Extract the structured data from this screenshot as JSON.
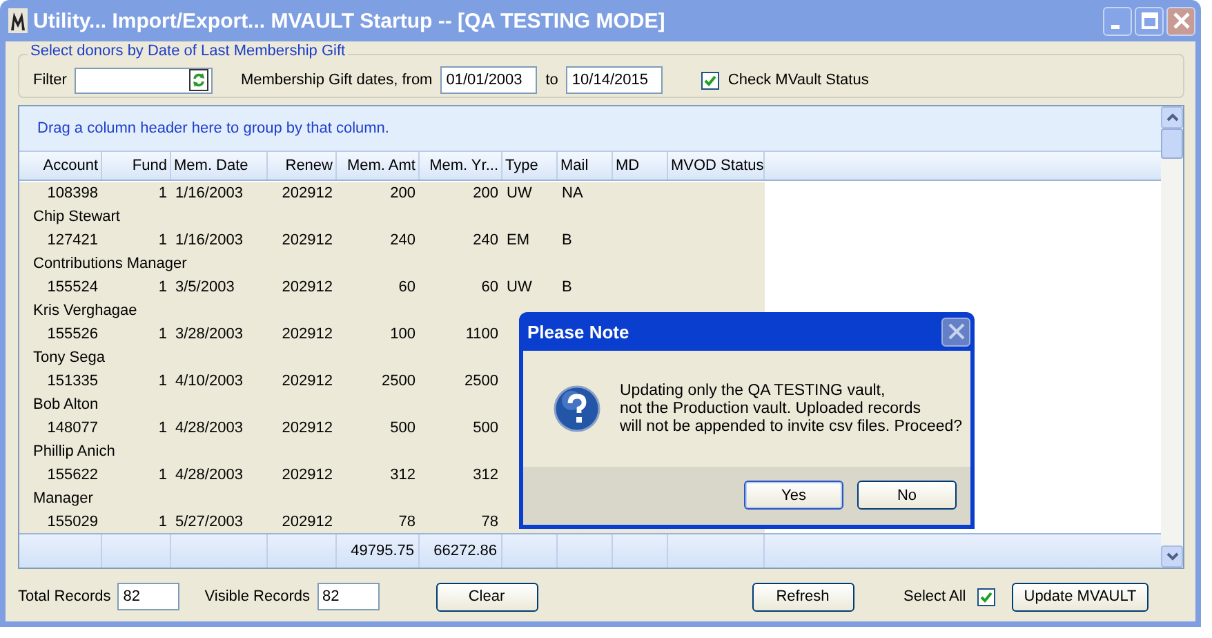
{
  "window": {
    "title": "Utility... Import/Export... MVAULT Startup -- [QA TESTING MODE]"
  },
  "criteria": {
    "legend": "Select donors by Date of Last Membership Gift",
    "filter_label": "Filter",
    "dates_label": "Membership Gift dates, from",
    "date_from": "01/01/2003",
    "to_label": "to",
    "date_to": "10/14/2015",
    "check_label": "Check MVault Status",
    "check_checked": true
  },
  "grid": {
    "group_hint": "Drag a column header here to group by that column.",
    "columns": [
      {
        "label": "Account"
      },
      {
        "label": "Fund"
      },
      {
        "label": "Mem. Date"
      },
      {
        "label": "Renew"
      },
      {
        "label": "Mem. Amt",
        "total": "49795.75"
      },
      {
        "label": "Mem. Yr...",
        "total": "66272.86"
      },
      {
        "label": "Type"
      },
      {
        "label": "Mail"
      },
      {
        "label": "MD"
      },
      {
        "label": "MVOD Status"
      }
    ],
    "rows": [
      {
        "cells": [
          "108398",
          "1",
          "1/16/2003",
          "202912",
          "200",
          "200",
          "UW",
          "NA"
        ],
        "preview": "Chip Stewart"
      },
      {
        "cells": [
          "127421",
          "1",
          "1/16/2003",
          "202912",
          "240",
          "240",
          "EM",
          "B"
        ],
        "preview": "Contributions Manager"
      },
      {
        "cells": [
          "155524",
          "1",
          "3/5/2003",
          "202912",
          "60",
          "60",
          "UW",
          "B"
        ],
        "preview": "Kris Verghagae"
      },
      {
        "cells": [
          "155526",
          "1",
          "3/28/2003",
          "202912",
          "100",
          "1100"
        ],
        "preview": "Tony Sega"
      },
      {
        "cells": [
          "151335",
          "1",
          "4/10/2003",
          "202912",
          "2500",
          "2500"
        ],
        "preview": "Bob Alton"
      },
      {
        "cells": [
          "148077",
          "1",
          "4/28/2003",
          "202912",
          "500",
          "500"
        ],
        "preview": "Phillip Anich"
      },
      {
        "cells": [
          "155622",
          "1",
          "4/28/2003",
          "202912",
          "312",
          "312"
        ],
        "preview": "Manager"
      },
      {
        "cells": [
          "155029",
          "1",
          "5/27/2003",
          "202912",
          "78",
          "78"
        ]
      }
    ]
  },
  "footer": {
    "total_label": "Total Records",
    "total_value": "82",
    "visible_label": "Visible Records",
    "visible_value": "82",
    "clear": "Clear",
    "refresh": "Refresh",
    "select_all_label": "Select All",
    "select_all_checked": true,
    "update": "Update MVAULT"
  },
  "dialog": {
    "title": "Please Note",
    "message": "Updating only the QA TESTING vault,\nnot the Production vault. Uploaded records\nwill not be appended to invite csv files. Proceed?",
    "buttons": [
      "Yes",
      "No"
    ]
  }
}
